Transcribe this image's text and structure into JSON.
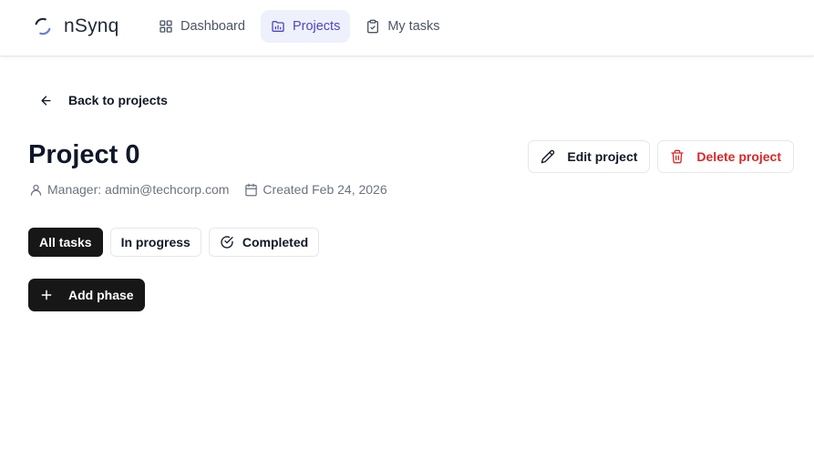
{
  "app": {
    "name": "nSynq",
    "accent": "#4f46c5"
  },
  "nav": {
    "items": [
      {
        "label": "Dashboard",
        "icon": "dashboard-grid-icon",
        "active": false
      },
      {
        "label": "Projects",
        "icon": "folder-icon",
        "active": true
      },
      {
        "label": "My tasks",
        "icon": "clipboard-check-icon",
        "active": false
      }
    ]
  },
  "back": {
    "label": "Back to projects"
  },
  "project": {
    "title": "Project 0",
    "manager": "Manager: admin@techcorp.com",
    "created": "Created Feb 24, 2026"
  },
  "actions": {
    "edit_label": "Edit project",
    "delete_label": "Delete project",
    "danger_color": "#dc2626"
  },
  "filters": [
    {
      "label": "All tasks",
      "active": true
    },
    {
      "label": "In progress",
      "active": false
    },
    {
      "label": "Completed",
      "active": false,
      "icon": "circle-check-icon"
    }
  ],
  "add_phase": {
    "label": "Add phase"
  }
}
